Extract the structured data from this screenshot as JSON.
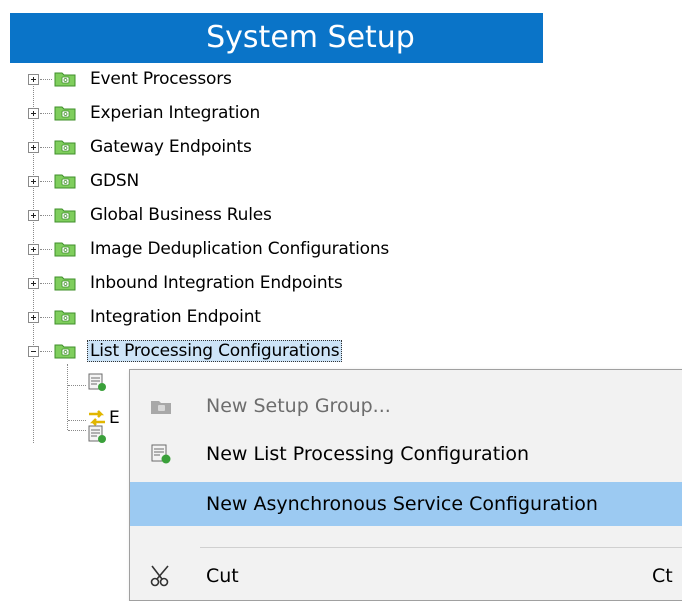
{
  "header": {
    "title": "System Setup"
  },
  "tree": {
    "items": [
      {
        "label": "Event Processors",
        "expanded": false
      },
      {
        "label": "Experian Integration",
        "expanded": false
      },
      {
        "label": "Gateway Endpoints",
        "expanded": false
      },
      {
        "label": "GDSN",
        "expanded": false
      },
      {
        "label": "Global Business Rules",
        "expanded": false
      },
      {
        "label": "Image Deduplication Configurations",
        "expanded": false
      },
      {
        "label": "Inbound Integration Endpoints",
        "expanded": false
      },
      {
        "label": "Integration Endpoint",
        "expanded": false
      },
      {
        "label": "List Processing Configurations",
        "expanded": true,
        "selected": true
      }
    ],
    "children": [
      {
        "icon": "list-config-icon",
        "label": ""
      },
      {
        "icon": "async-service-icon",
        "label": "E"
      },
      {
        "icon": "list-config-icon",
        "label": ""
      }
    ]
  },
  "context_menu": {
    "items": [
      {
        "label": "New Setup Group...",
        "icon": "folder-icon",
        "disabled": true
      },
      {
        "label": "New List Processing Configuration",
        "icon": "list-config-icon"
      },
      {
        "label": "New Asynchronous Service Configuration",
        "icon": "",
        "highlighted": true
      },
      {
        "label": "Cut",
        "icon": "scissors-icon",
        "shortcut": "Ct"
      }
    ]
  },
  "colors": {
    "header_bg": "#0a74c8",
    "selection_bg": "#cde4f7",
    "menu_highlight": "#9ccaf2",
    "folder_green": "#7fce5d"
  }
}
